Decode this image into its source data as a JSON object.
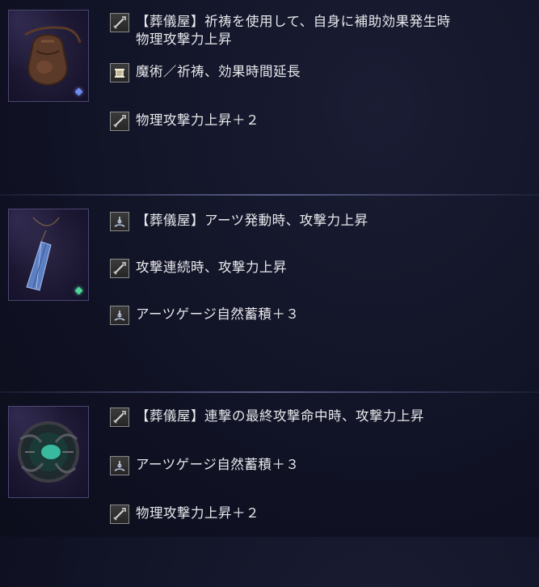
{
  "relics": [
    {
      "item_icon": "pouch-relic-icon",
      "gem_color": "#6f8cf0",
      "effects": [
        {
          "icon": "sword-icon",
          "text": "【葬儀屋】祈祷を使用して、自身に補助効果発生時",
          "text_line2": "物理攻撃力上昇"
        },
        {
          "icon": "scroll-icon",
          "text": "魔術／祈祷、効果時間延長"
        },
        {
          "icon": "sword-icon",
          "text": "物理攻撃力上昇＋２"
        }
      ]
    },
    {
      "item_icon": "crystal-pendant-relic-icon",
      "gem_color": "#4fd59a",
      "effects": [
        {
          "icon": "arts-icon",
          "text": "【葬儀屋】アーツ発動時、攻撃力上昇"
        },
        {
          "icon": "sword-icon",
          "text": "攻撃連続時、攻撃力上昇"
        },
        {
          "icon": "arts-icon",
          "text": "アーツゲージ自然蓄積＋３"
        }
      ]
    },
    {
      "item_icon": "thorn-orb-relic-icon",
      "effects": [
        {
          "icon": "sword-icon",
          "text": "【葬儀屋】連撃の最終攻撃命中時、攻撃力上昇"
        },
        {
          "icon": "arts-icon",
          "text": "アーツゲージ自然蓄積＋３"
        },
        {
          "icon": "sword-icon",
          "text": "物理攻撃力上昇＋２"
        }
      ]
    }
  ]
}
